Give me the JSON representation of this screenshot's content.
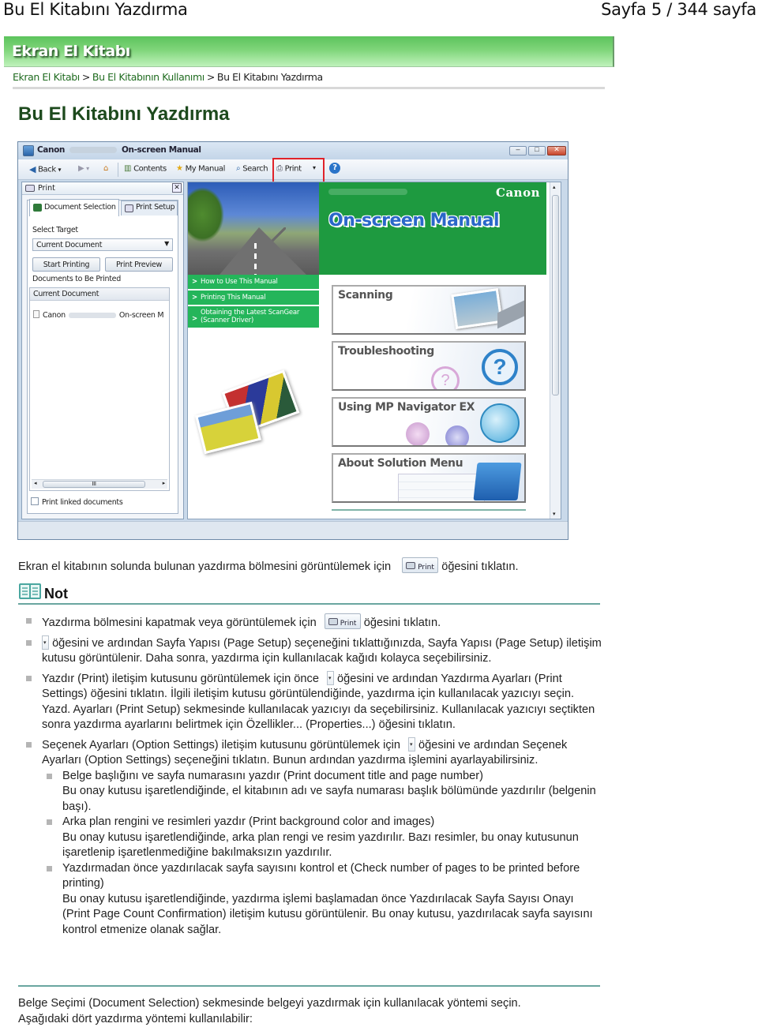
{
  "page_header": {
    "doc_title": "Bu El Kitabını Yazdırma",
    "page_indicator": "Sayfa 5 / 344 sayfa"
  },
  "banner": {
    "title": "Ekran El Kitabı"
  },
  "breadcrumb": {
    "items": [
      "Ekran El Kitabı",
      "Bu El Kitabının Kullanımı"
    ],
    "separator": ">",
    "current": "Bu El Kitabını Yazdırma"
  },
  "main_title": "Bu El Kitabını Yazdırma",
  "screenshot": {
    "window_title_prefix": "Canon",
    "window_title_suffix": "On-screen Manual",
    "window_controls": {
      "minimize": "–",
      "maximize": "□",
      "close": "✕"
    },
    "toolbar": {
      "back": "Back",
      "contents": "Contents",
      "my_manual": "My Manual",
      "search": "Search",
      "print": "Print",
      "dropdown": "▾",
      "help": "?"
    },
    "highlight_color": "#e0232a",
    "print_panel": {
      "header": "Print",
      "close": "✕",
      "tabs": [
        "Document Selection",
        "Print Setup"
      ],
      "select_target_label": "Select Target",
      "select_target_value": "Current Document",
      "buttons": [
        "Start Printing",
        "Print Preview"
      ],
      "documents_label": "Documents to Be Printed",
      "list_header": "Current Document",
      "list_item_prefix": "Canon",
      "list_item_suffix": "On-screen M",
      "scroll_thumb": "III",
      "checkbox_label": "Print linked documents",
      "checkbox_checked": false
    },
    "home": {
      "brand": "Canon",
      "hero_title": "On-screen Manual",
      "nav_links": [
        "How to Use This Manual",
        "Printing This Manual",
        "Obtaining the Latest ScanGear (Scanner Driver)"
      ],
      "cards": [
        "Scanning",
        "Troubleshooting",
        "Using MP Navigator EX",
        "About Solution Menu"
      ]
    }
  },
  "intro": {
    "before": "Ekran el kitabının solunda bulunan yazdırma bölmesini görüntülemek için",
    "button_label": "Print",
    "after": "öğesini tıklatın."
  },
  "note": {
    "title": "Not",
    "items": [
      {
        "before": "Yazdırma bölmesini kapatmak veya görüntülemek için",
        "button_label": "Print",
        "after": "öğesini tıklatın."
      },
      {
        "after": "öğesini ve ardından Sayfa Yapısı (Page Setup) seçeneğini tıklattığınızda, Sayfa Yapısı (Page Setup) iletişim kutusu görüntülenir. Daha sonra, yazdırma için kullanılacak kağıdı kolayca seçebilirsiniz."
      },
      {
        "before": "Yazdır (Print) iletişim kutusunu görüntülemek için önce",
        "after": "öğesini ve ardından Yazdırma Ayarları (Print Settings) öğesini tıklatın. İlgili iletişim kutusu görüntülendiğinde, yazdırma için kullanılacak yazıcıyı seçin. Yazd. Ayarları (Print Setup) sekmesinde kullanılacak yazıcıyı da seçebilirsiniz. Kullanılacak yazıcıyı seçtikten sonra yazdırma ayarlarını belirtmek için Özellikler... (Properties...) öğesini tıklatın."
      },
      {
        "before": "Seçenek Ayarları (Option Settings) iletişim kutusunu görüntülemek için",
        "after": "öğesini ve ardından Seçenek Ayarları (Option Settings) seçeneğini tıklatın. Bunun ardından yazdırma işlemini ayarlayabilirsiniz."
      }
    ],
    "sub_items": [
      {
        "title": "Belge başlığını ve sayfa numarasını yazdır (Print document title and page number)",
        "desc": "Bu onay kutusu işaretlendiğinde, el kitabının adı ve sayfa numarası başlık bölümünde yazdırılır (belgenin başı)."
      },
      {
        "title": "Arka plan rengini ve resimleri yazdır (Print background color and images)",
        "desc": "Bu onay kutusu işaretlendiğinde, arka plan rengi ve resim yazdırılır. Bazı resimler, bu onay kutusunun işaretlenip işaretlenmediğine bakılmaksızın yazdırılır."
      },
      {
        "title": "Yazdırmadan önce yazdırılacak sayfa sayısını kontrol et (Check number of pages to be printed before printing)",
        "desc": "Bu onay kutusu işaretlendiğinde, yazdırma işlemi başlamadan önce Yazdırılacak Sayfa Sayısı Onayı (Print Page Count Confirmation) iletişim kutusu görüntülenir. Bu onay kutusu, yazdırılacak sayfa sayısını kontrol etmenize olanak sağlar."
      }
    ]
  },
  "outro": {
    "line1": "Belge Seçimi (Document Selection) sekmesinde belgeyi yazdırmak için kullanılacak yöntemi seçin.",
    "line2": "Aşağıdaki dört yazdırma yöntemi kullanılabilir:"
  },
  "colors": {
    "banner_green": "#5cc35c",
    "title_green": "#1d4a1d",
    "link_green": "#1f6b1f",
    "rule_teal": "#6aa6a0",
    "hero_green": "#1e9a40",
    "nav_green": "#24b55a"
  }
}
